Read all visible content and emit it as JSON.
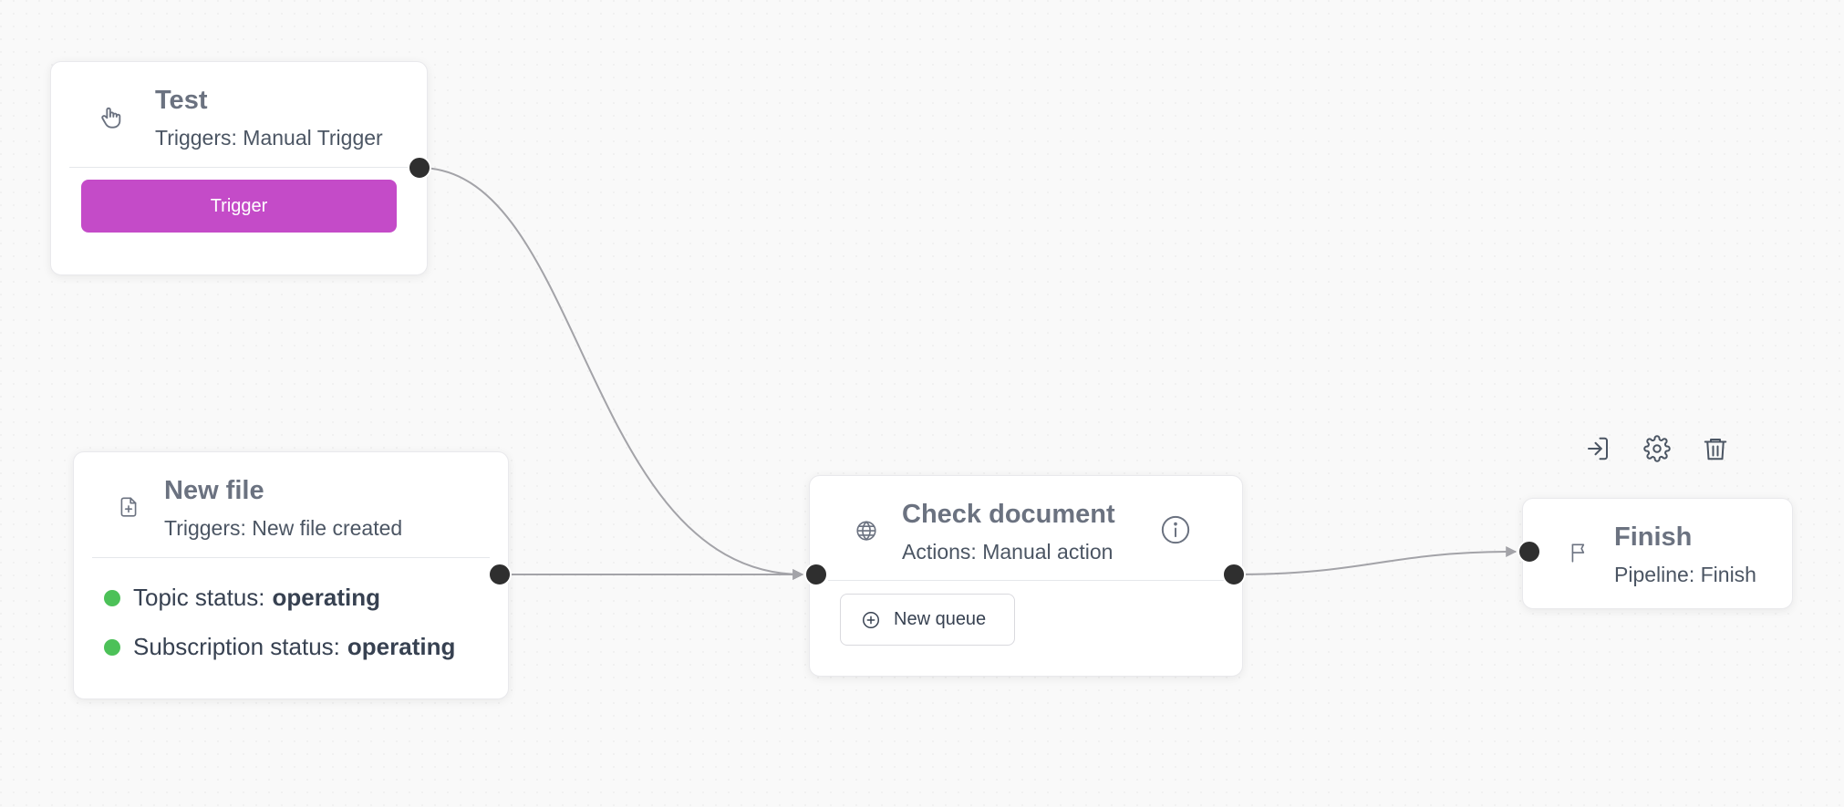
{
  "nodes": {
    "test": {
      "title": "Test",
      "subtitle": "Triggers: Manual Trigger",
      "icon": "hand-icon",
      "button_label": "Trigger",
      "button_color": "#c44bc8"
    },
    "new_file": {
      "title": "New file",
      "subtitle": "Triggers: New file created",
      "icon": "file-plus-icon",
      "statuses": [
        {
          "label": "Topic status:",
          "value": "operating"
        },
        {
          "label": "Subscription status:",
          "value": "operating"
        }
      ],
      "status_color": "#4cc158"
    },
    "check_document": {
      "title": "Check document",
      "subtitle": "Actions: Manual action",
      "icon": "globe-icon",
      "info_icon": "info-icon",
      "queue_button_label": "New queue"
    },
    "finish": {
      "title": "Finish",
      "subtitle": "Pipeline: Finish",
      "icon": "flag-icon"
    }
  },
  "toolbar": {
    "icons": [
      "log-in-icon",
      "gear-icon",
      "trash-icon"
    ]
  },
  "edges": [
    {
      "from": "test",
      "to": "check_document"
    },
    {
      "from": "new_file",
      "to": "check_document"
    },
    {
      "from": "check_document",
      "to": "finish"
    }
  ]
}
